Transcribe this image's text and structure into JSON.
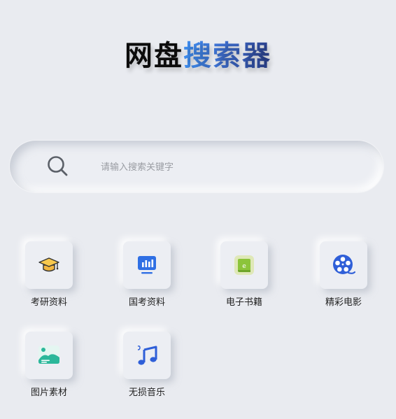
{
  "header": {
    "title_part1": "网盘",
    "title_part2": "搜索器"
  },
  "search": {
    "placeholder": "请输入搜索关键字",
    "value": ""
  },
  "categories": [
    {
      "label": "考研资料",
      "icon": "graduation-cap-icon"
    },
    {
      "label": "国考资料",
      "icon": "presentation-chart-icon"
    },
    {
      "label": "电子书籍",
      "icon": "ebook-icon"
    },
    {
      "label": "精彩电影",
      "icon": "film-reel-icon"
    },
    {
      "label": "图片素材",
      "icon": "image-icon"
    },
    {
      "label": "无损音乐",
      "icon": "music-note-icon"
    }
  ],
  "colors": {
    "background": "#e9ebf0",
    "accent_blue": "#2f6fe4",
    "ebook_green": "#8cc43a",
    "image_teal": "#2bb79a"
  }
}
